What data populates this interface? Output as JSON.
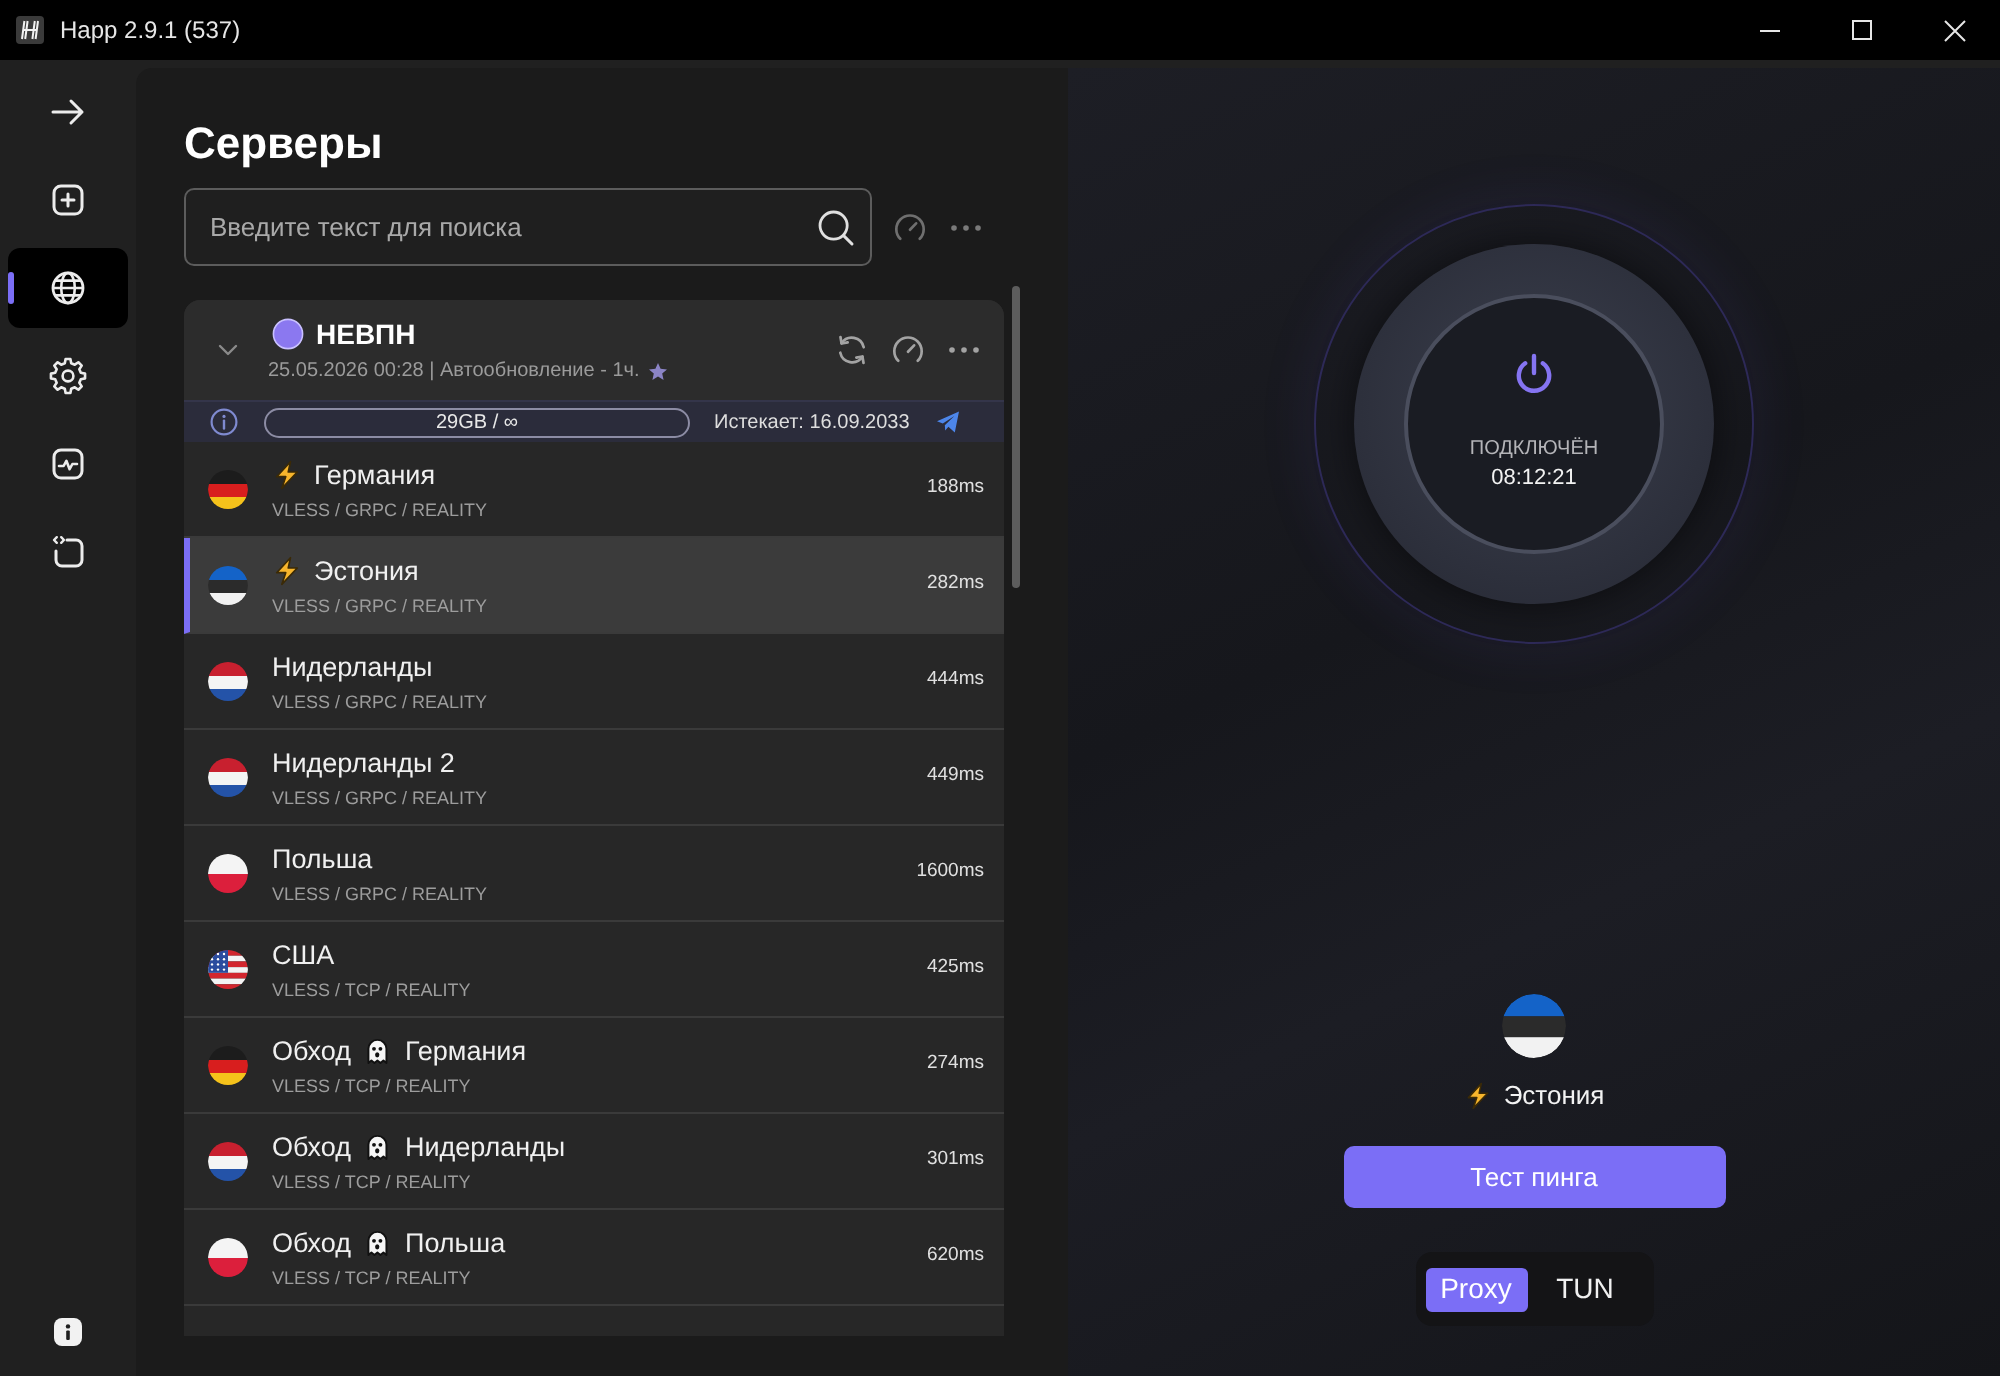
{
  "window": {
    "title": "Happ 2.9.1 (537)"
  },
  "sidebar": {
    "items": [
      {
        "kind": "arrow",
        "selected": false
      },
      {
        "kind": "add",
        "selected": false
      },
      {
        "kind": "globe",
        "selected": true
      },
      {
        "kind": "settings",
        "selected": false
      },
      {
        "kind": "stats",
        "selected": false
      },
      {
        "kind": "code",
        "selected": false
      }
    ]
  },
  "servers_page": {
    "title": "Серверы",
    "search": {
      "placeholder": "Введите текст для поиска"
    },
    "group": {
      "name": "НЕВПН",
      "expanded": true,
      "updated": "25.05.2026 00:28 | Автообновление - 1ч.",
      "traffic": "29GB / ∞",
      "expires": "Истекает: 16.09.2033",
      "servers": [
        {
          "flag": {
            "kind": "germany"
          },
          "kind": "bolt",
          "name": "Германия",
          "protocol": "VLESS / GRPC / REALITY",
          "ping": "188ms",
          "selected": false
        },
        {
          "flag": {
            "kind": "estonia"
          },
          "kind": "bolt",
          "name": "Эстония",
          "protocol": "VLESS / GRPC / REALITY",
          "ping": "282ms",
          "selected": true
        },
        {
          "flag": {
            "kind": "netherlands"
          },
          "kind": "plain",
          "name": "Нидерланды",
          "protocol": "VLESS / GRPC / REALITY",
          "ping": "444ms",
          "selected": false
        },
        {
          "flag": {
            "kind": "netherlands"
          },
          "kind": "plain",
          "name": "Нидерланды 2",
          "protocol": "VLESS / GRPC / REALITY",
          "ping": "449ms",
          "selected": false
        },
        {
          "flag": {
            "kind": "poland"
          },
          "kind": "plain",
          "name": "Польша",
          "protocol": "VLESS / GRPC / REALITY",
          "ping": "1600ms",
          "selected": false
        },
        {
          "flag": {
            "kind": "usa"
          },
          "kind": "plain",
          "name": "США",
          "protocol": "VLESS / TCP / REALITY",
          "ping": "425ms",
          "selected": false
        },
        {
          "flag": {
            "kind": "germany"
          },
          "kind": "ghost",
          "prefix": "Обход",
          "name": "Германия",
          "protocol": "VLESS / TCP / REALITY",
          "ping": "274ms",
          "selected": false
        },
        {
          "flag": {
            "kind": "netherlands"
          },
          "kind": "ghost",
          "prefix": "Обход",
          "name": "Нидерланды",
          "protocol": "VLESS / TCP / REALITY",
          "ping": "301ms",
          "selected": false
        },
        {
          "flag": {
            "kind": "poland"
          },
          "kind": "ghost",
          "prefix": "Обход",
          "name": "Польша",
          "protocol": "VLESS / TCP / REALITY",
          "ping": "620ms",
          "selected": false
        }
      ]
    }
  },
  "connection": {
    "status": "ПОДКЛЮЧЁН",
    "timer": "08:12:21",
    "server": {
      "flag": {
        "kind": "estonia"
      },
      "kind": "bolt",
      "name": "Эстония"
    },
    "ping_button": "Тест пинга",
    "modes": [
      {
        "label": "Proxy",
        "selected": true
      },
      {
        "label": "TUN",
        "selected": false
      }
    ]
  }
}
